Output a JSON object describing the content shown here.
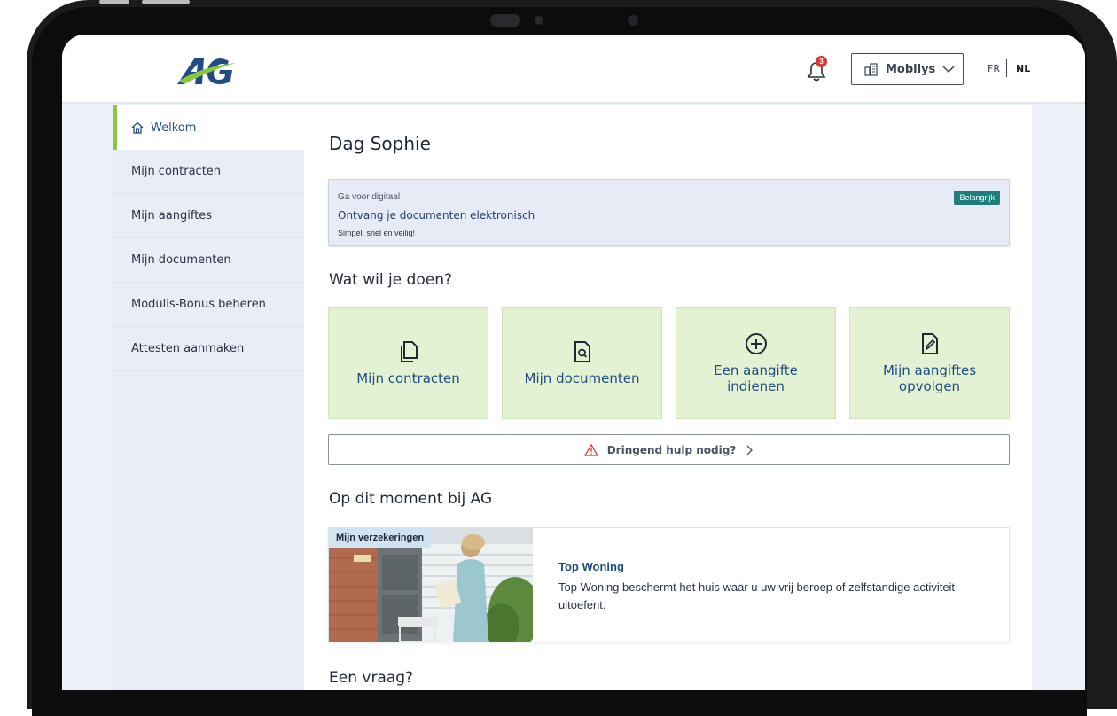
{
  "header": {
    "notifications_count": "3",
    "org_select_label": "Mobilys",
    "lang_fr": "FR",
    "lang_nl": "NL"
  },
  "sidebar": {
    "items": [
      {
        "label": "Welkom",
        "active": true
      },
      {
        "label": "Mijn contracten"
      },
      {
        "label": "Mijn aangiftes"
      },
      {
        "label": "Mijn documenten"
      },
      {
        "label": "Modulis-Bonus beheren"
      },
      {
        "label": "Attesten aanmaken"
      }
    ]
  },
  "main": {
    "greeting": "Dag Sophie",
    "notice": {
      "kicker": "Ga voor digitaal",
      "title": "Ontvang je documenten elektronisch",
      "subtitle": "Simpel, snel en veilig!",
      "badge": "Belangrijk"
    },
    "actions_heading": "Wat wil je doen?",
    "tiles": [
      {
        "line1": "Mijn contracten",
        "line2": "",
        "icon": "copy-document-icon"
      },
      {
        "line1": "Mijn documenten",
        "line2": "",
        "icon": "document-search-icon"
      },
      {
        "line1": "Een aangifte",
        "line2": "indienen",
        "icon": "plus-circle-icon"
      },
      {
        "line1": "Mijn aangiftes",
        "line2": "opvolgen",
        "icon": "document-edit-icon"
      }
    ],
    "help_button": "Dringend hulp nodig?",
    "news_heading": "Op dit moment bij AG",
    "promo": {
      "tag": "Mijn verzekeringen",
      "title": "Top Woning",
      "text": "Top Woning beschermt het huis waar u uw vrij beroep of zelfstandige activiteit uitoefent."
    },
    "question_heading": "Een vraag?"
  },
  "colors": {
    "accent_green": "#8cc63e",
    "brand_blue": "#1f4d82",
    "tile_bg": "#e3f2d2",
    "badge_teal": "#1e7e7e",
    "alert_red": "#d43c3c"
  }
}
